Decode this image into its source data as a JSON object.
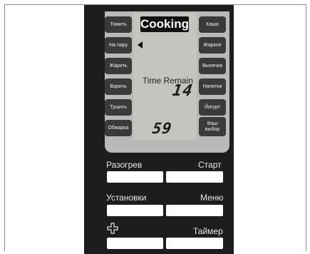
{
  "display": {
    "status": "Cooking",
    "time_label": "Time Remain",
    "time_value_1": "14",
    "time_value_2": "59"
  },
  "modes_left": [
    "Томить",
    "На пару",
    "Жарить",
    "Варить",
    "Тушить",
    "Обжарка"
  ],
  "modes_right": [
    "Каша",
    "Жаркое",
    "Выпечка",
    "Напитки",
    "Йогурт",
    "Ваш выбор"
  ],
  "buttons": {
    "reheat": "Разогрев",
    "start": "Старт",
    "settings": "Установки",
    "menu": "Меню",
    "timer": "Таймер"
  },
  "colors": {
    "panel": "#1d1d1d",
    "display": "#b9b9b9",
    "lcd": "#c3c6bf",
    "mode_button": "#3a3a3a"
  }
}
